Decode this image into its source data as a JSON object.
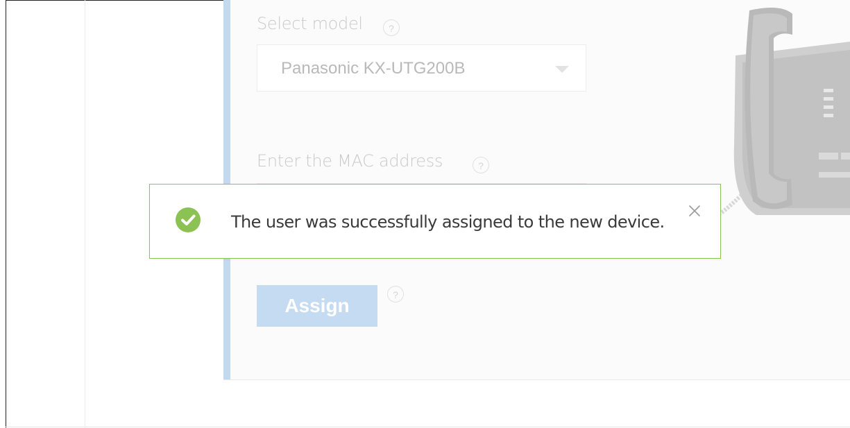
{
  "form": {
    "model_label": "Select model",
    "model_help": "?",
    "model_selected": "Panasonic KX-UTG200B",
    "mac_label": "Enter the MAC address",
    "mac_help": "?",
    "mac_value": "",
    "assign_label": "Assign",
    "assign_help": "?"
  },
  "toast": {
    "message": "The user was successfully assigned to the new device.",
    "status": "success",
    "close_icon": "close-icon"
  },
  "colors": {
    "accent_bar": "#c3d9ef",
    "assign_button": "#c4dbf1",
    "toast_border": "#8cc153",
    "success_icon": "#8cc153"
  }
}
